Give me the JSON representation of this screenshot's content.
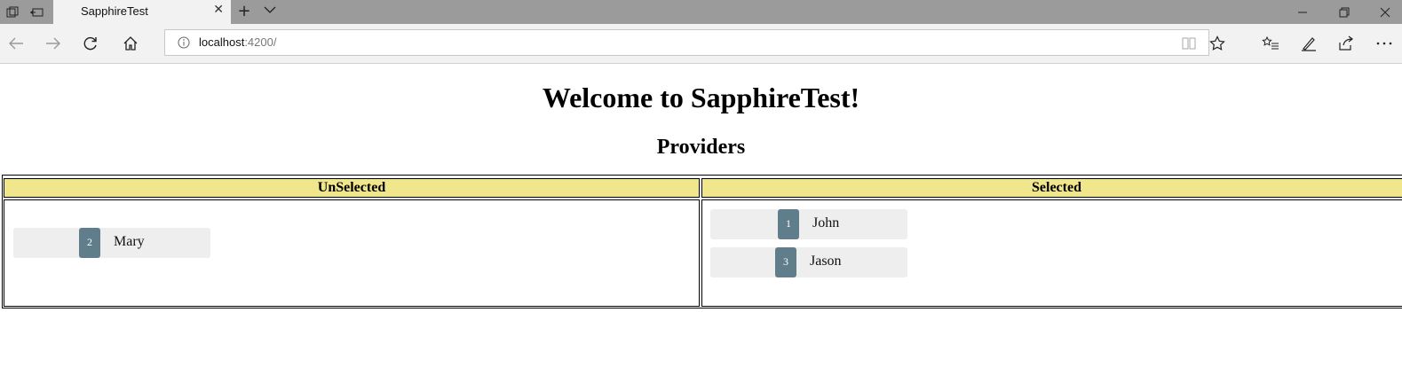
{
  "browser": {
    "tab_title": "SapphireTest",
    "address": {
      "host": "localhost",
      "rest": ":4200/"
    }
  },
  "page": {
    "title": "Welcome to SapphireTest!",
    "subtitle": "Providers"
  },
  "table": {
    "columns": [
      "UnSelected",
      "Selected"
    ],
    "unselected": [
      {
        "id": "2",
        "name": "Mary"
      }
    ],
    "selected": [
      {
        "id": "1",
        "name": "John"
      },
      {
        "id": "3",
        "name": "Jason"
      }
    ]
  },
  "colors": {
    "header_bg": "#f0e68c",
    "badge_bg": "#607d8b",
    "chip_bg": "#eeeeee"
  }
}
